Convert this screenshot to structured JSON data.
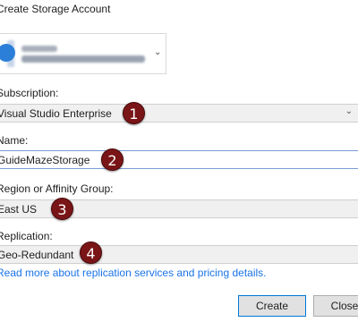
{
  "window": {
    "title": "Create Storage Account"
  },
  "account": {
    "chevron_icon": "chevron-down-icon"
  },
  "subscription": {
    "label": "Subscription:",
    "value": "Visual Studio Enterprise",
    "badge": "1"
  },
  "name": {
    "label": "Name:",
    "value": "GuideMazeStorage",
    "badge": "2"
  },
  "region": {
    "label": "Region or Affinity Group:",
    "value": "East US",
    "badge": "3"
  },
  "replication": {
    "label": "Replication:",
    "value": "Geo-Redundant",
    "badge": "4"
  },
  "link": {
    "text": "Read more about replication services and pricing details."
  },
  "buttons": {
    "create": "Create",
    "close": "Close"
  },
  "colors": {
    "badge": "#7a1517",
    "link": "#1a73e8",
    "accent": "#0078d7"
  }
}
